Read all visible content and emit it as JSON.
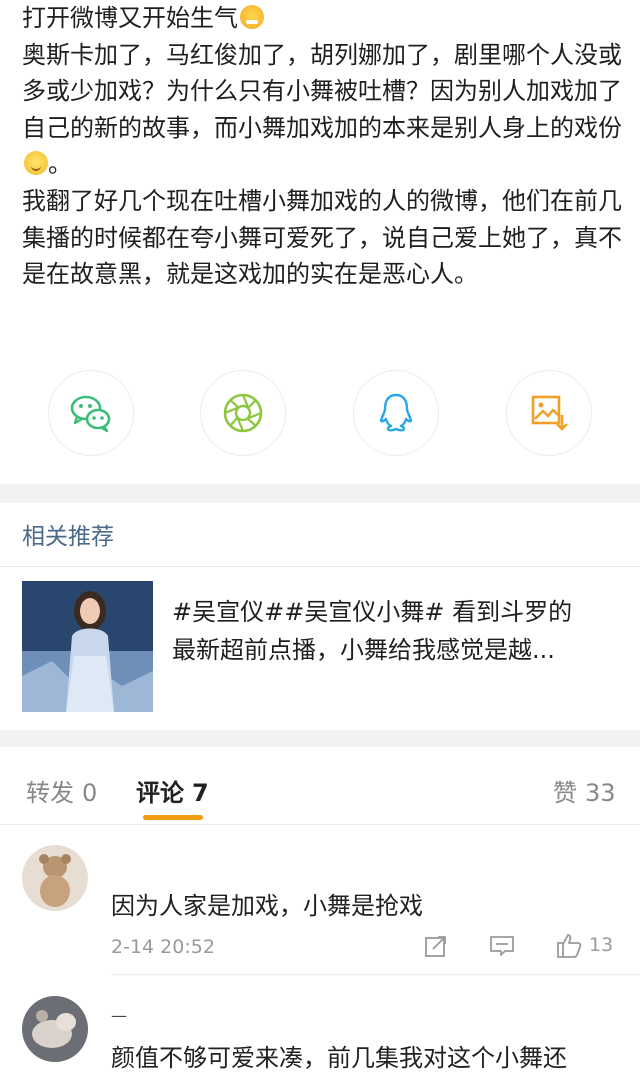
{
  "post": {
    "lines": [
      "打开微博又开始生气",
      "奥斯卡加了，马红俊加了，胡列娜加了，剧里哪个人没或多或少加戏？为什么只有小舞被吐槽？因为别人加戏加了自己的新的故事，而小舞加戏加的本来是别人身上的戏份",
      "。",
      "我翻了好几个现在吐槽小舞加戏的人的微博，他们在前几集播的时候都在夸小舞可爱死了，说自己爱上她了，真不是在故意黑，就是这戏加的实在是恶心人。"
    ],
    "emoji_1": "angry-face-emoji",
    "emoji_2": "smile-emoji"
  },
  "share": [
    {
      "icon": "wechat-icon",
      "color": "#3bbd77"
    },
    {
      "icon": "moments-shutter-icon",
      "color": "#8dc63f"
    },
    {
      "icon": "qq-icon",
      "color": "#2aa7e8"
    },
    {
      "icon": "save-image-icon",
      "color": "#f0a028"
    }
  ],
  "related": {
    "title": "相关推荐",
    "line1": "#吴宣仪##吴宣仪小舞# 看到斗罗的",
    "line2": "最新超前点播，小舞给我感觉是越...",
    "thumb_icon": "recommended-post-thumbnail"
  },
  "tabs": {
    "repost_label": "转发",
    "repost_count": "0",
    "comment_label": "评论",
    "comment_count": "7",
    "like_label": "赞",
    "like_count": "33",
    "accent": "#f39c12"
  },
  "comments": [
    {
      "text": "因为人家是加戏，小舞是抢戏",
      "time": "2-14 20:52",
      "likes": "13"
    },
    {
      "name": "—",
      "text": "颜值不够可爱来凑，前几集我对这个小舞还"
    }
  ]
}
